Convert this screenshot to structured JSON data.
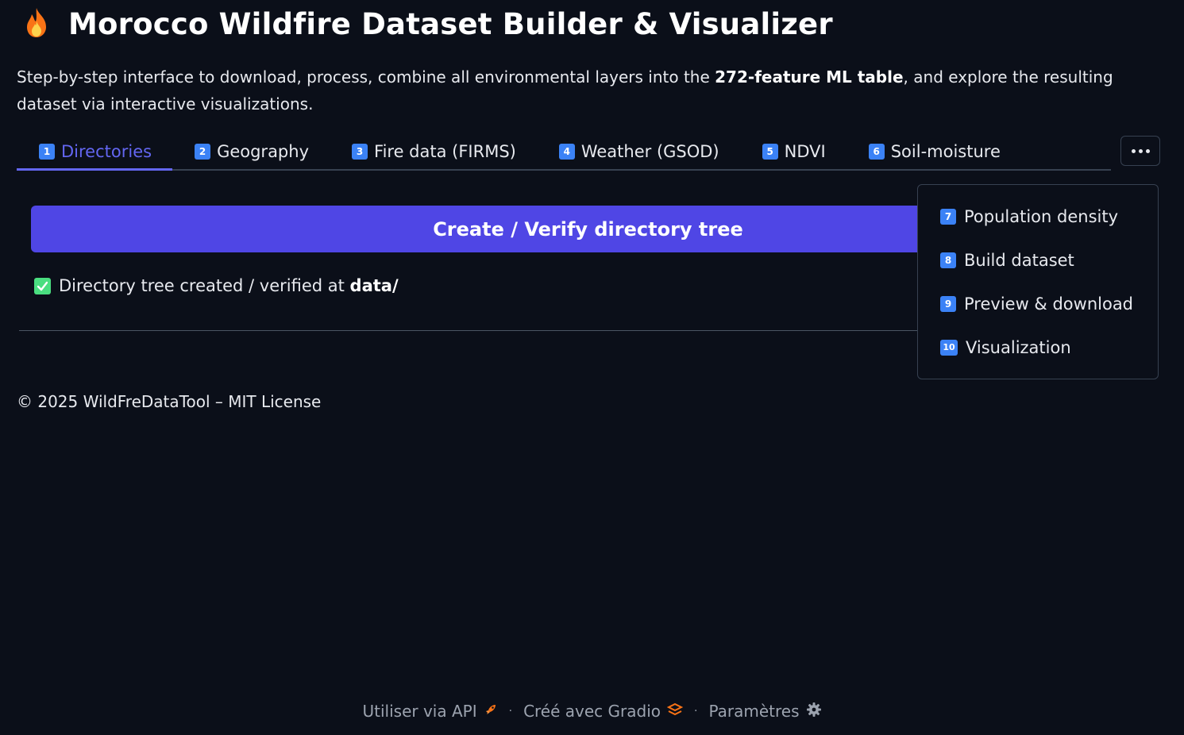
{
  "header": {
    "title": "Morocco Wildfire Dataset Builder & Visualizer",
    "icon": "fire-icon"
  },
  "description": {
    "text_before": "Step-by-step interface to download, process, combine all environmental layers into the ",
    "bold": "272-feature ML table",
    "text_after": ", and explore the resulting dataset via interactive visualizations."
  },
  "tabs": [
    {
      "num": "1",
      "label": "Directories",
      "active": true
    },
    {
      "num": "2",
      "label": "Geography"
    },
    {
      "num": "3",
      "label": "Fire data (FIRMS)"
    },
    {
      "num": "4",
      "label": "Weather (GSOD)"
    },
    {
      "num": "5",
      "label": "NDVI"
    },
    {
      "num": "6",
      "label": "Soil-moisture"
    }
  ],
  "overflow_menu": [
    {
      "num": "7",
      "label": "Population density"
    },
    {
      "num": "8",
      "label": "Build dataset"
    },
    {
      "num": "9",
      "label": "Preview & download"
    },
    {
      "num": "10",
      "label": "Visualization"
    }
  ],
  "main": {
    "button_label": "Create / Verify directory tree",
    "status_text": "Directory tree created / verified at ",
    "status_path": "data/"
  },
  "license": "© 2025 WildFreDataTool – MIT License",
  "footer": {
    "api": "Utiliser via API",
    "gradio": "Créé avec Gradio",
    "settings": "Paramètres",
    "separator": "·"
  },
  "colors": {
    "background": "#0b0f19",
    "accent": "#6366f1",
    "button": "#4f46e5",
    "badge": "#3b82f6",
    "check": "#4ade80"
  }
}
